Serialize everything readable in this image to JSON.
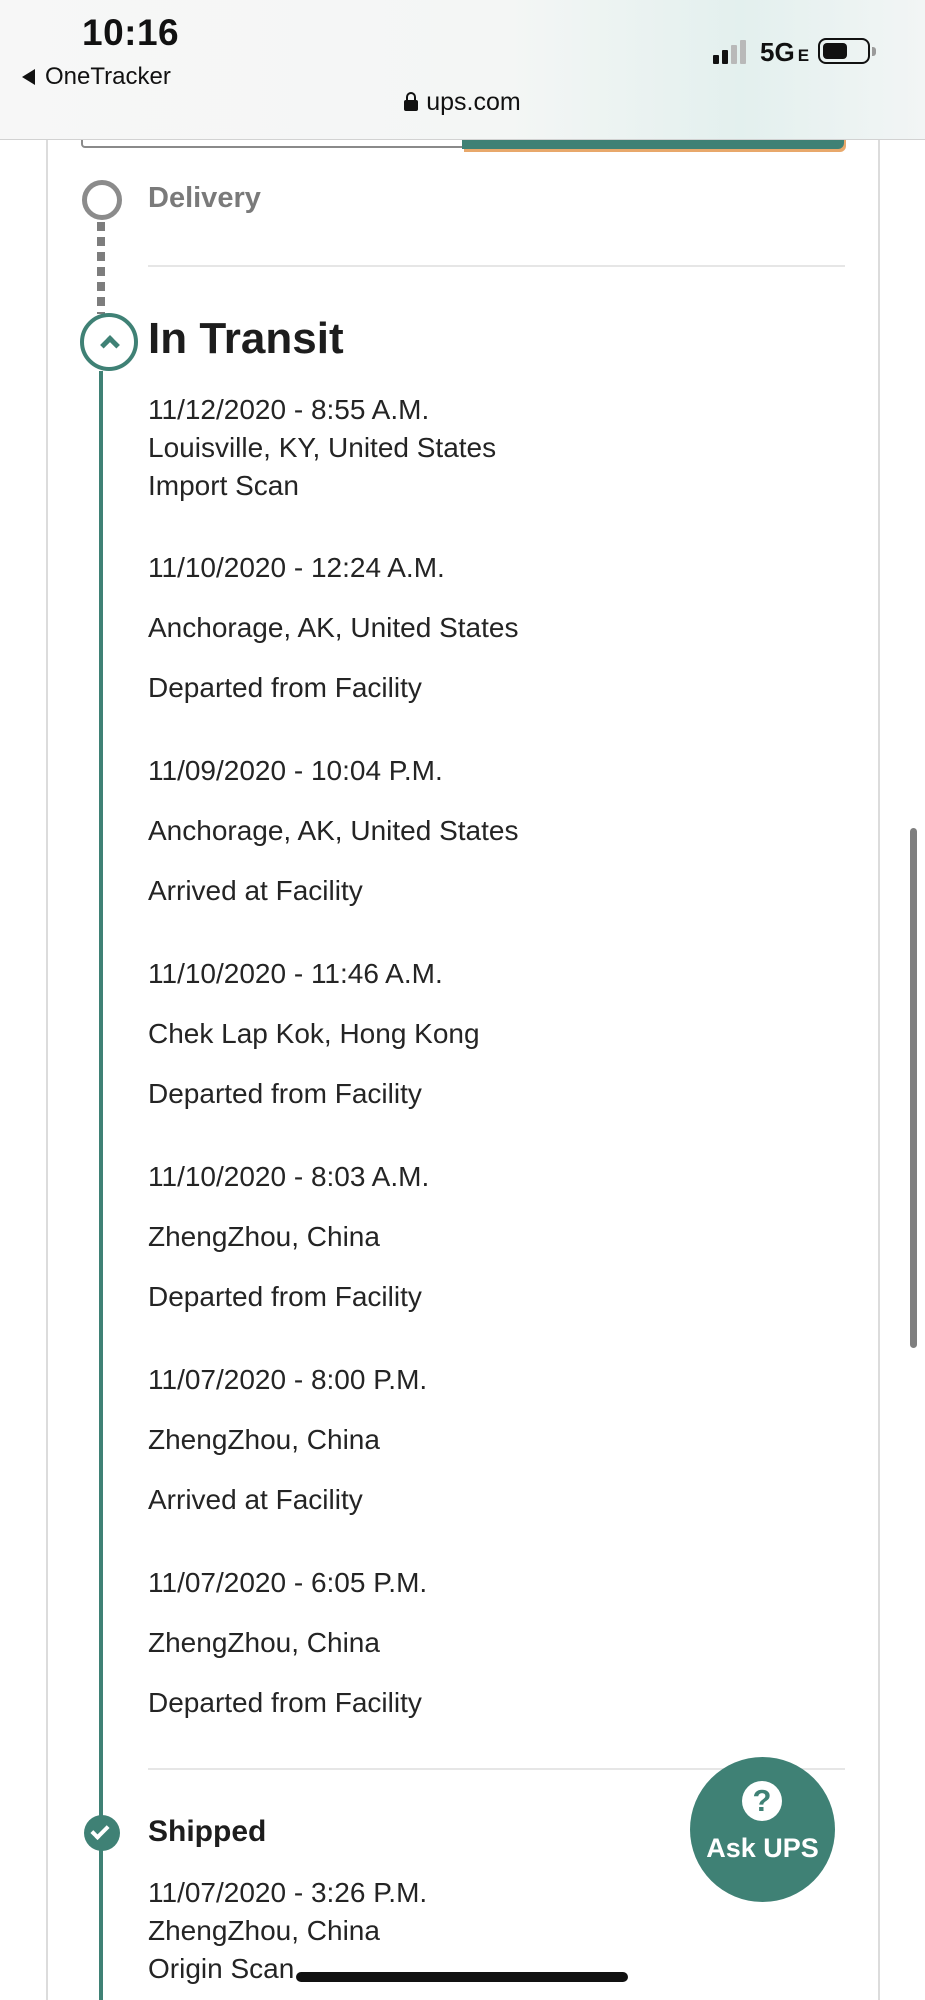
{
  "status_bar": {
    "time": "10:16",
    "back_app": "OneTracker",
    "network": "5G",
    "network_suffix": "E",
    "url": "ups.com"
  },
  "timeline": {
    "delivery_label": "Delivery",
    "in_transit_label": "In Transit",
    "shipped_label": "Shipped",
    "in_transit_events": [
      {
        "datetime": "11/12/2020 - 8:55 A.M.",
        "location": "Louisville, KY, United States",
        "activity": "Import Scan"
      },
      {
        "datetime": "11/10/2020 - 12:24 A.M.",
        "location": "Anchorage, AK, United States",
        "activity": "Departed from Facility"
      },
      {
        "datetime": "11/09/2020 - 10:04 P.M.",
        "location": "Anchorage, AK, United States",
        "activity": "Arrived at Facility"
      },
      {
        "datetime": "11/10/2020 - 11:46 A.M.",
        "location": "Chek Lap Kok, Hong Kong",
        "activity": "Departed from Facility"
      },
      {
        "datetime": "11/10/2020 - 8:03 A.M.",
        "location": "ZhengZhou, China",
        "activity": "Departed from Facility"
      },
      {
        "datetime": "11/07/2020 - 8:00 P.M.",
        "location": "ZhengZhou, China",
        "activity": "Arrived at Facility"
      },
      {
        "datetime": "11/07/2020 - 6:05 P.M.",
        "location": "ZhengZhou, China",
        "activity": "Departed from Facility"
      }
    ],
    "shipped_events": [
      {
        "datetime": "11/07/2020 - 3:26 P.M.",
        "location": "ZhengZhou, China",
        "activity": "Origin Scan"
      }
    ]
  },
  "ask_ups": {
    "icon": "question-icon",
    "glyph": "?",
    "label": "Ask UPS"
  },
  "colors": {
    "accent": "#3f8175",
    "inactive": "#8b8b8b"
  }
}
